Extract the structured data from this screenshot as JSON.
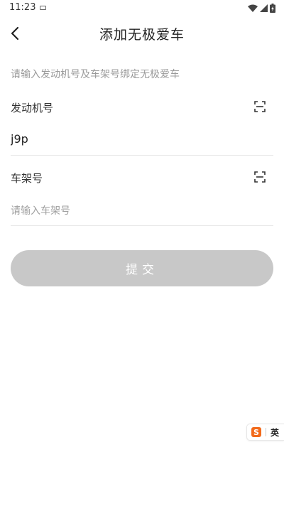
{
  "status_bar": {
    "time": "11:23",
    "icons": [
      "sim-card-icon",
      "wifi-icon",
      "signal-icon",
      "battery-charging-icon"
    ]
  },
  "header": {
    "title": "添加无极爱车",
    "back_icon": "chevron-left-icon"
  },
  "hint": "请输入发动机号及车架号绑定无极爱车",
  "engine_field": {
    "label": "发动机号",
    "value": "j9p",
    "scan_icon": "scan-icon"
  },
  "frame_field": {
    "label": "车架号",
    "value": "",
    "placeholder": "请输入车架号",
    "scan_icon": "scan-icon"
  },
  "submit": {
    "label": "提交",
    "bg_color": "#c8c8c8"
  },
  "ime": {
    "logo_letter": "S",
    "lang": "英",
    "accent": "#f26a1b"
  }
}
